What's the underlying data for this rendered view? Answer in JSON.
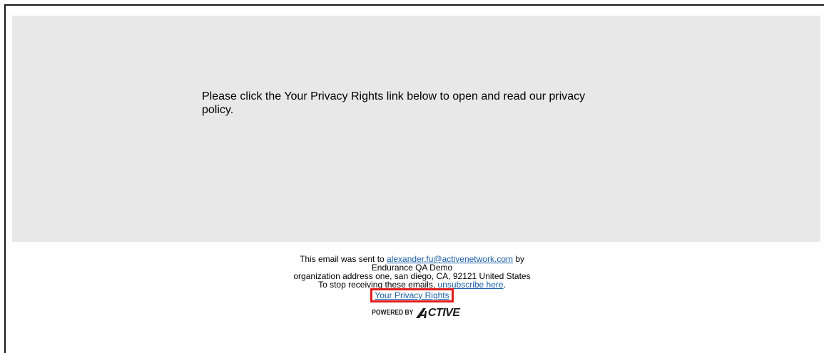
{
  "panel": {
    "message": "Please click the Your Privacy Rights link below to open and read our privacy policy."
  },
  "footer": {
    "sent_prefix": "This email was sent to ",
    "email": "alexander.fu@activenetwork.com",
    "sent_suffix": " by",
    "org_name": "Endurance QA Demo",
    "address": "organization address one, san diego, CA, 92121 United States",
    "stop_prefix": "To stop receiving these emails, ",
    "unsubscribe_label": "unsubscribe here",
    "stop_suffix": ".",
    "privacy_label": "Your Privacy Rights",
    "powered_by": "POWERED BY",
    "brand": "CTIVE"
  },
  "colors": {
    "panel_bg": "#e8e8e8",
    "link": "#1a5fa8",
    "highlight_border": "#e31b1b"
  }
}
